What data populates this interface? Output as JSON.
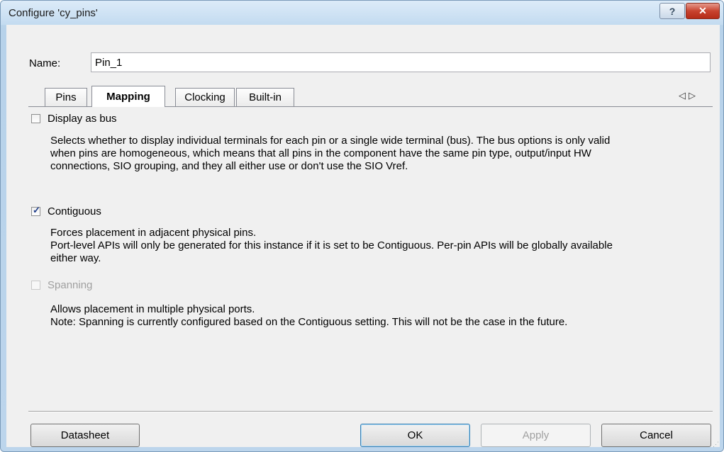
{
  "window": {
    "title": "Configure 'cy_pins'",
    "help_glyph": "?",
    "close_glyph": "✕"
  },
  "name_field": {
    "label": "Name:",
    "value": "Pin_1"
  },
  "tabs": [
    {
      "label": "Pins",
      "active": false
    },
    {
      "label": "Mapping",
      "active": true
    },
    {
      "label": "Clocking",
      "active": false
    },
    {
      "label": "Built-in",
      "active": false
    }
  ],
  "tab_scroll": {
    "left": "◁",
    "right": "▷"
  },
  "options": [
    {
      "label": "Display as bus",
      "checked": false,
      "enabled": true,
      "description": "Selects whether to display individual terminals for each pin or a single wide terminal (bus). The bus options is only valid\nwhen pins are homogeneous, which means that all pins in the component have the same pin type, output/input HW\nconnections,  SIO grouping, and they all either use or don't use the SIO Vref."
    },
    {
      "label": "Contiguous",
      "checked": true,
      "enabled": true,
      "description": "Forces placement in adjacent physical pins.\nPort-level APIs will only be generated for this instance if it is set to be Contiguous. Per-pin APIs will be globally available\neither way."
    },
    {
      "label": "Spanning",
      "checked": false,
      "enabled": false,
      "description": "Allows placement in multiple physical ports.\nNote: Spanning is currently configured based on the Contiguous setting. This will not be the case in the future."
    }
  ],
  "buttons": {
    "datasheet": "Datasheet",
    "ok": "OK",
    "apply": "Apply",
    "cancel": "Cancel"
  },
  "colors": {
    "title_bar": "#c9dff1",
    "dialog_bg": "#f0f0f0",
    "close_red": "#c8432f",
    "check_blue": "#1f3d8a"
  }
}
